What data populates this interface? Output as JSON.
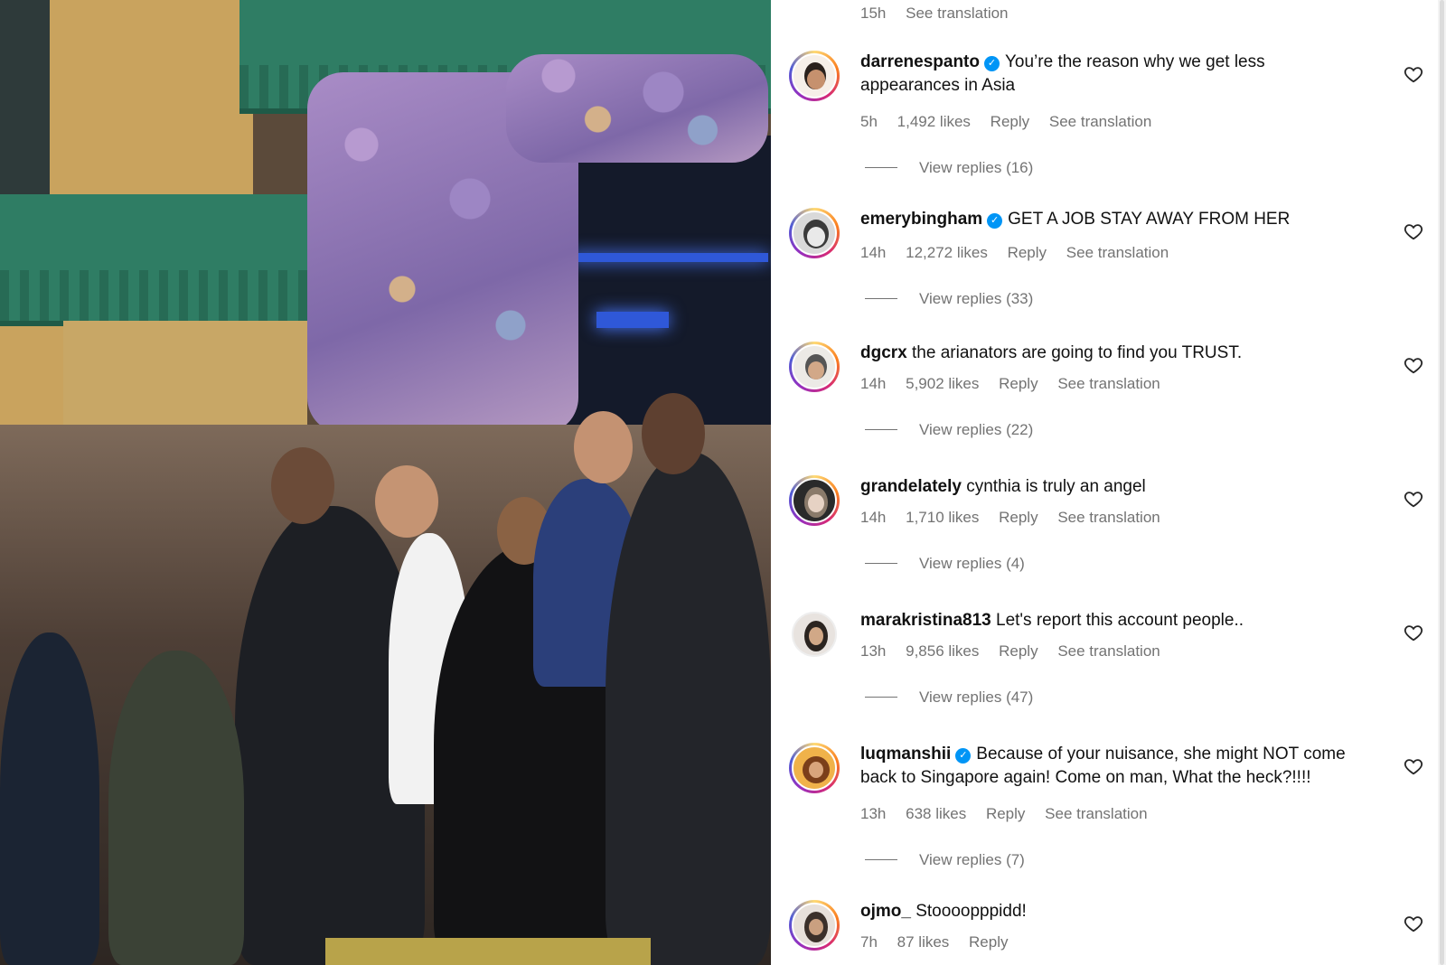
{
  "top_meta": {
    "time": "15h",
    "see_translation": "See translation"
  },
  "comments": [
    {
      "username": "darrenespanto",
      "verified": true,
      "text": "You’re the reason why we get less appearances in Asia",
      "time": "5h",
      "likes": "1,492 likes",
      "reply": "Reply",
      "see_translation": "See translation",
      "view_replies": "View replies (16)"
    },
    {
      "username": "emerybingham",
      "verified": true,
      "text": "GET A JOB STAY AWAY FROM HER",
      "time": "14h",
      "likes": "12,272 likes",
      "reply": "Reply",
      "see_translation": "See translation",
      "view_replies": "View replies (33)"
    },
    {
      "username": "dgcrx",
      "verified": false,
      "text": "the arianators are going to find you TRUST.",
      "time": "14h",
      "likes": "5,902 likes",
      "reply": "Reply",
      "see_translation": "See translation",
      "view_replies": "View replies (22)"
    },
    {
      "username": "grandelately",
      "verified": false,
      "text": "cynthia is truly an angel",
      "time": "14h",
      "likes": "1,710 likes",
      "reply": "Reply",
      "see_translation": "See translation",
      "view_replies": "View replies (4)"
    },
    {
      "username": "marakristina813",
      "verified": false,
      "text": "Let's report this account people..",
      "time": "13h",
      "likes": "9,856 likes",
      "reply": "Reply",
      "see_translation": "See translation",
      "view_replies": "View replies (47)"
    },
    {
      "username": "luqmanshii",
      "verified": true,
      "text": "Because of your nuisance, she might NOT come back to Singapore again! Come on man, What the heck?!!!!",
      "time": "13h",
      "likes": "638 likes",
      "reply": "Reply",
      "see_translation": "See translation",
      "view_replies": "View replies (7)"
    },
    {
      "username": "ojmo_",
      "verified": false,
      "text": "Stoooopppidd!",
      "time": "7h",
      "likes": "87 likes",
      "reply": "Reply"
    }
  ],
  "icons": {
    "like": "heart-outline-icon",
    "verified": "verified-badge-icon"
  },
  "colors": {
    "verified": "#0095f6",
    "meta_text": "#737373",
    "text": "#111111"
  }
}
